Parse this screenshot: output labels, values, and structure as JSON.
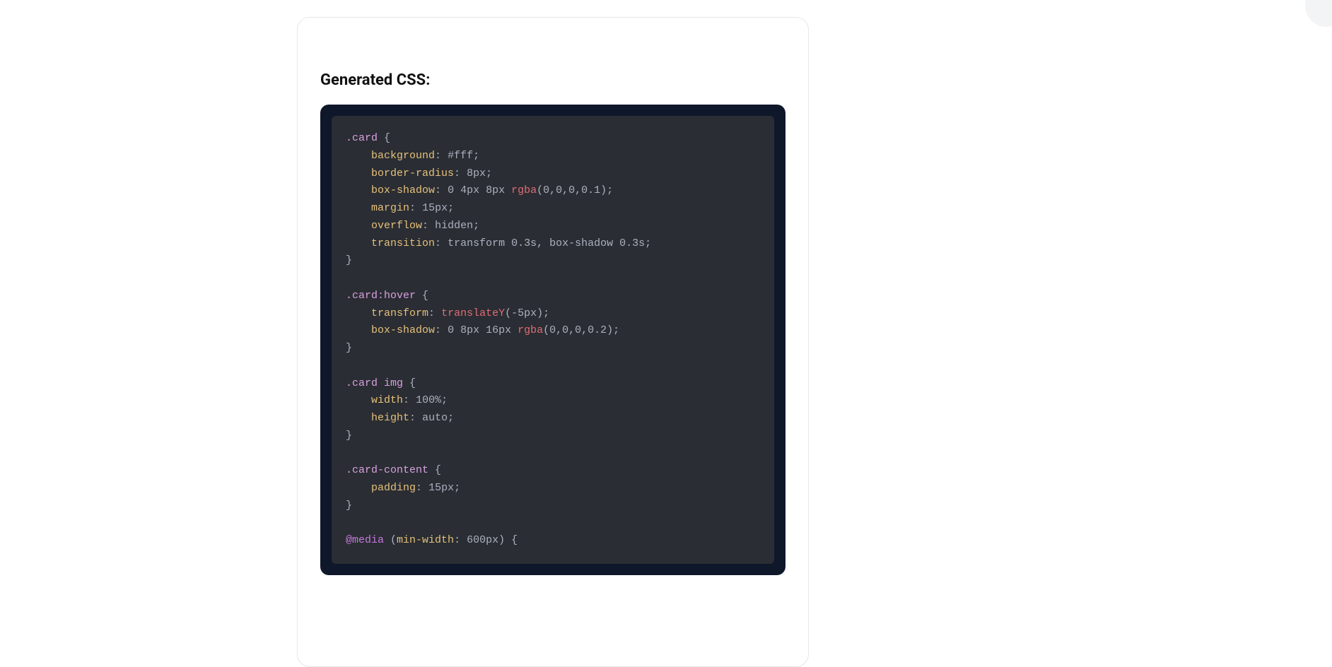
{
  "heading": "Generated CSS:",
  "code": {
    "rules": [
      {
        "selector": ".card",
        "decls": [
          {
            "prop": "background",
            "value": "#fff"
          },
          {
            "prop": "border-radius",
            "value": "8px"
          },
          {
            "prop": "box-shadow",
            "value_prefix": "0 4px 8px ",
            "func": "rgba",
            "args": "(0,0,0,0.1)"
          },
          {
            "prop": "margin",
            "value": "15px"
          },
          {
            "prop": "overflow",
            "value": "hidden"
          },
          {
            "prop": "transition",
            "value": "transform 0.3s, box-shadow 0.3s"
          }
        ]
      },
      {
        "selector": ".card:hover",
        "decls": [
          {
            "prop": "transform",
            "func": "translateY",
            "args": "(-5px)"
          },
          {
            "prop": "box-shadow",
            "value_prefix": "0 8px 16px ",
            "func": "rgba",
            "args": "(0,0,0,0.2)"
          }
        ]
      },
      {
        "selector": ".card img",
        "decls": [
          {
            "prop": "width",
            "value": "100%"
          },
          {
            "prop": "height",
            "value": "auto"
          }
        ]
      },
      {
        "selector": ".card-content",
        "decls": [
          {
            "prop": "padding",
            "value": "15px"
          }
        ]
      }
    ],
    "media": {
      "keyword": "@media",
      "condition_open": "(",
      "condition_prop": "min-width",
      "condition_sep": ": ",
      "condition_val": "600px",
      "condition_close": ") {"
    }
  }
}
